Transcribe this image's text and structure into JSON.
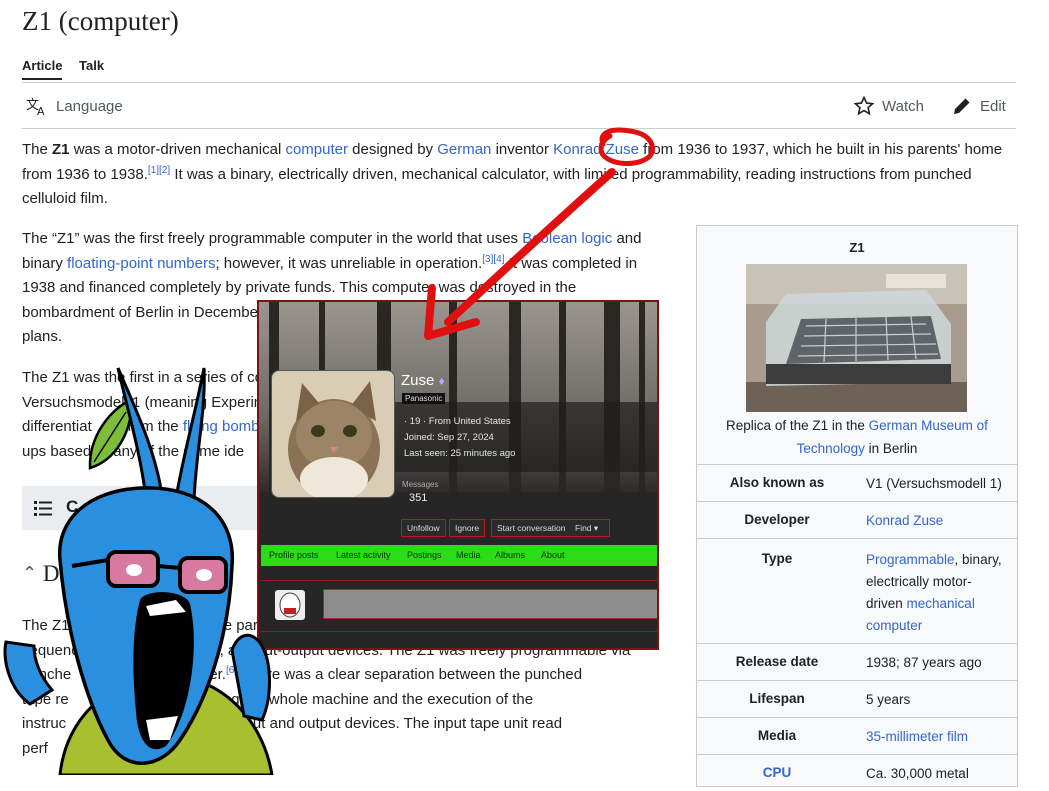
{
  "page": {
    "title": "Z1 (computer)"
  },
  "tabs": [
    {
      "label": "Article"
    },
    {
      "label": "Talk"
    }
  ],
  "toolbar": {
    "language": "Language",
    "watch": "Watch",
    "edit": "Edit"
  },
  "para1": {
    "p1": "The ",
    "b": "Z1",
    "p2": " was a motor-driven mechanical ",
    "l1": "computer",
    "p3": " designed by ",
    "l2": "German",
    "p4": " inventor ",
    "l3": "Konrad Zuse",
    "p5": " from 1936 to 1937, which he built in his parents' home",
    "p6": "from 1936 to 1938.",
    "r1": "[1][2]",
    "p7": " It was a binary, electrically driven, mechanical calculator, with limited programmability, reading instructions from punched",
    "p8": "celluloid film."
  },
  "para2": {
    "p1": "The “Z1” was the first freely programmable computer in the world that uses ",
    "l1": "Boolean logic",
    "p2": " and",
    "p3": "binary ",
    "l2": "floating-point numbers",
    "p4": "; however, it was unreliable in operation.",
    "r1": "[3][4]",
    "p5": " It was completed in",
    "p6": "1938 and financed completely by private funds. This computer was destroyed in the",
    "p7": "bombardment of Berlin in Decembe",
    "p8": "plans."
  },
  "para3": {
    "p1": "The Z1 was the first in a series of co",
    "p2": "Versuchsmodell 1 (meaning Experim",
    "p3": "differentiat",
    "p3b": "rom the ",
    "l1": "flying bomb",
    "p4": "ups based",
    "p4b": "any of the same ide"
  },
  "toc": {
    "label": "C"
  },
  "section": {
    "title": "D"
  },
  "para4": {
    "p1": "The Z1 c",
    "p1b": "the par",
    "p2": "sequenc",
    "p2b": "logic, an",
    "p2c": "input-output devices. The Z1 was freely programmable via",
    "p3": "punche",
    "p3b": "ed tap",
    "p3c": "der.",
    "r1": "[6]",
    "p3d": " There was a clear separation between the punched",
    "p4": "tape re",
    "p4b": "it for sup",
    "p4c": "rvising the whole machine and the execution of the",
    "p5": "instruc",
    "p5b": "c unit, and",
    "p5c": "e input and output devices. The input tape unit read",
    "p6": "perf",
    "p6b": "film.",
    "r2": "[7]"
  },
  "infobox": {
    "title": "Z1",
    "caption_pre": "Replica of the Z1 in the ",
    "caption_link": "German Museum of Technology",
    "caption_post": " in Berlin",
    "rows": [
      {
        "label": "Also known as",
        "value": "V1 (Versuchsmodell 1)"
      },
      {
        "label": "Developer",
        "value": "Konrad Zuse"
      },
      {
        "label": "Type",
        "v1": "Programmable",
        "v2": ", binary,",
        "v3": "electrically motor-",
        "v4": "driven ",
        "v5": "mechanical",
        "v6": "computer"
      },
      {
        "label": "Release date",
        "value": "1938; 87 years ago"
      },
      {
        "label": "Lifespan",
        "value": "5 years"
      },
      {
        "label": "Media",
        "value": "35-millimeter film"
      },
      {
        "label": "CPU",
        "value": "Ca. 30,000 metal"
      }
    ]
  },
  "profile": {
    "name": "Zuse",
    "badge": "Panasonic",
    "info1": "· 19 · From United States",
    "info2": "Joined: Sep 27, 2024",
    "info3": "Last seen: 25 minutes ago",
    "messages_label": "Messages",
    "messages_count": "351",
    "buttons": [
      "Unfollow",
      "Ignore",
      "Start conversation",
      "Find ▾"
    ],
    "nav": [
      "Profile posts",
      "Latest activity",
      "Postings",
      "Media",
      "Albums",
      "About"
    ]
  },
  "colors": {
    "link": "#3366cc",
    "nav_green": "#2cdc18",
    "annotation_red": "#e01010",
    "wojak_blue": "#2b8fe0"
  }
}
